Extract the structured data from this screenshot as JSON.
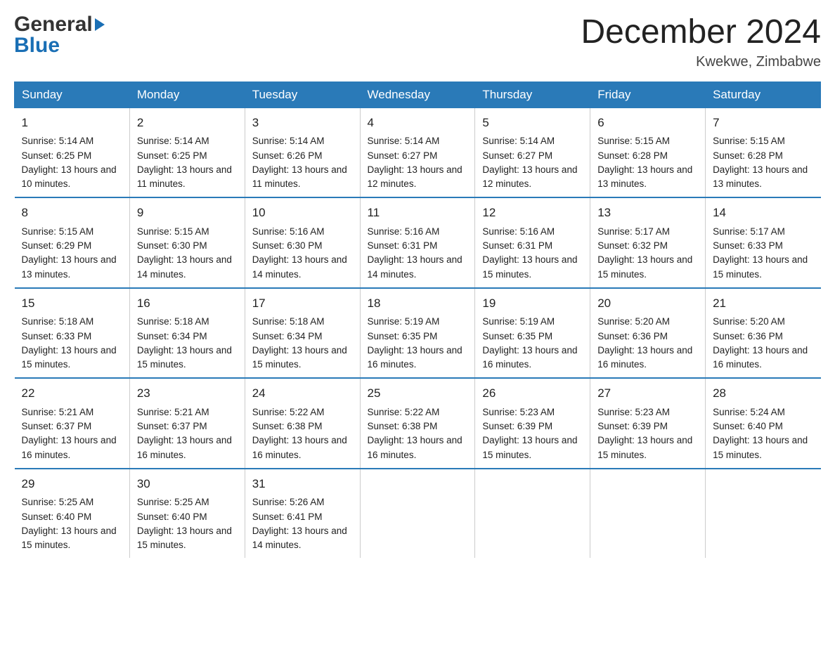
{
  "header": {
    "month_title": "December 2024",
    "location": "Kwekwe, Zimbabwe",
    "logo_general": "General",
    "logo_blue": "Blue"
  },
  "days_of_week": [
    "Sunday",
    "Monday",
    "Tuesday",
    "Wednesday",
    "Thursday",
    "Friday",
    "Saturday"
  ],
  "weeks": [
    {
      "days": [
        {
          "num": "1",
          "sunrise": "5:14 AM",
          "sunset": "6:25 PM",
          "daylight": "13 hours and 10 minutes."
        },
        {
          "num": "2",
          "sunrise": "5:14 AM",
          "sunset": "6:25 PM",
          "daylight": "13 hours and 11 minutes."
        },
        {
          "num": "3",
          "sunrise": "5:14 AM",
          "sunset": "6:26 PM",
          "daylight": "13 hours and 11 minutes."
        },
        {
          "num": "4",
          "sunrise": "5:14 AM",
          "sunset": "6:27 PM",
          "daylight": "13 hours and 12 minutes."
        },
        {
          "num": "5",
          "sunrise": "5:14 AM",
          "sunset": "6:27 PM",
          "daylight": "13 hours and 12 minutes."
        },
        {
          "num": "6",
          "sunrise": "5:15 AM",
          "sunset": "6:28 PM",
          "daylight": "13 hours and 13 minutes."
        },
        {
          "num": "7",
          "sunrise": "5:15 AM",
          "sunset": "6:28 PM",
          "daylight": "13 hours and 13 minutes."
        }
      ]
    },
    {
      "days": [
        {
          "num": "8",
          "sunrise": "5:15 AM",
          "sunset": "6:29 PM",
          "daylight": "13 hours and 13 minutes."
        },
        {
          "num": "9",
          "sunrise": "5:15 AM",
          "sunset": "6:30 PM",
          "daylight": "13 hours and 14 minutes."
        },
        {
          "num": "10",
          "sunrise": "5:16 AM",
          "sunset": "6:30 PM",
          "daylight": "13 hours and 14 minutes."
        },
        {
          "num": "11",
          "sunrise": "5:16 AM",
          "sunset": "6:31 PM",
          "daylight": "13 hours and 14 minutes."
        },
        {
          "num": "12",
          "sunrise": "5:16 AM",
          "sunset": "6:31 PM",
          "daylight": "13 hours and 15 minutes."
        },
        {
          "num": "13",
          "sunrise": "5:17 AM",
          "sunset": "6:32 PM",
          "daylight": "13 hours and 15 minutes."
        },
        {
          "num": "14",
          "sunrise": "5:17 AM",
          "sunset": "6:33 PM",
          "daylight": "13 hours and 15 minutes."
        }
      ]
    },
    {
      "days": [
        {
          "num": "15",
          "sunrise": "5:18 AM",
          "sunset": "6:33 PM",
          "daylight": "13 hours and 15 minutes."
        },
        {
          "num": "16",
          "sunrise": "5:18 AM",
          "sunset": "6:34 PM",
          "daylight": "13 hours and 15 minutes."
        },
        {
          "num": "17",
          "sunrise": "5:18 AM",
          "sunset": "6:34 PM",
          "daylight": "13 hours and 15 minutes."
        },
        {
          "num": "18",
          "sunrise": "5:19 AM",
          "sunset": "6:35 PM",
          "daylight": "13 hours and 16 minutes."
        },
        {
          "num": "19",
          "sunrise": "5:19 AM",
          "sunset": "6:35 PM",
          "daylight": "13 hours and 16 minutes."
        },
        {
          "num": "20",
          "sunrise": "5:20 AM",
          "sunset": "6:36 PM",
          "daylight": "13 hours and 16 minutes."
        },
        {
          "num": "21",
          "sunrise": "5:20 AM",
          "sunset": "6:36 PM",
          "daylight": "13 hours and 16 minutes."
        }
      ]
    },
    {
      "days": [
        {
          "num": "22",
          "sunrise": "5:21 AM",
          "sunset": "6:37 PM",
          "daylight": "13 hours and 16 minutes."
        },
        {
          "num": "23",
          "sunrise": "5:21 AM",
          "sunset": "6:37 PM",
          "daylight": "13 hours and 16 minutes."
        },
        {
          "num": "24",
          "sunrise": "5:22 AM",
          "sunset": "6:38 PM",
          "daylight": "13 hours and 16 minutes."
        },
        {
          "num": "25",
          "sunrise": "5:22 AM",
          "sunset": "6:38 PM",
          "daylight": "13 hours and 16 minutes."
        },
        {
          "num": "26",
          "sunrise": "5:23 AM",
          "sunset": "6:39 PM",
          "daylight": "13 hours and 15 minutes."
        },
        {
          "num": "27",
          "sunrise": "5:23 AM",
          "sunset": "6:39 PM",
          "daylight": "13 hours and 15 minutes."
        },
        {
          "num": "28",
          "sunrise": "5:24 AM",
          "sunset": "6:40 PM",
          "daylight": "13 hours and 15 minutes."
        }
      ]
    },
    {
      "days": [
        {
          "num": "29",
          "sunrise": "5:25 AM",
          "sunset": "6:40 PM",
          "daylight": "13 hours and 15 minutes."
        },
        {
          "num": "30",
          "sunrise": "5:25 AM",
          "sunset": "6:40 PM",
          "daylight": "13 hours and 15 minutes."
        },
        {
          "num": "31",
          "sunrise": "5:26 AM",
          "sunset": "6:41 PM",
          "daylight": "13 hours and 14 minutes."
        },
        {
          "num": "",
          "sunrise": "",
          "sunset": "",
          "daylight": ""
        },
        {
          "num": "",
          "sunrise": "",
          "sunset": "",
          "daylight": ""
        },
        {
          "num": "",
          "sunrise": "",
          "sunset": "",
          "daylight": ""
        },
        {
          "num": "",
          "sunrise": "",
          "sunset": "",
          "daylight": ""
        }
      ]
    }
  ],
  "labels": {
    "sunrise_prefix": "Sunrise: ",
    "sunset_prefix": "Sunset: ",
    "daylight_prefix": "Daylight: "
  }
}
